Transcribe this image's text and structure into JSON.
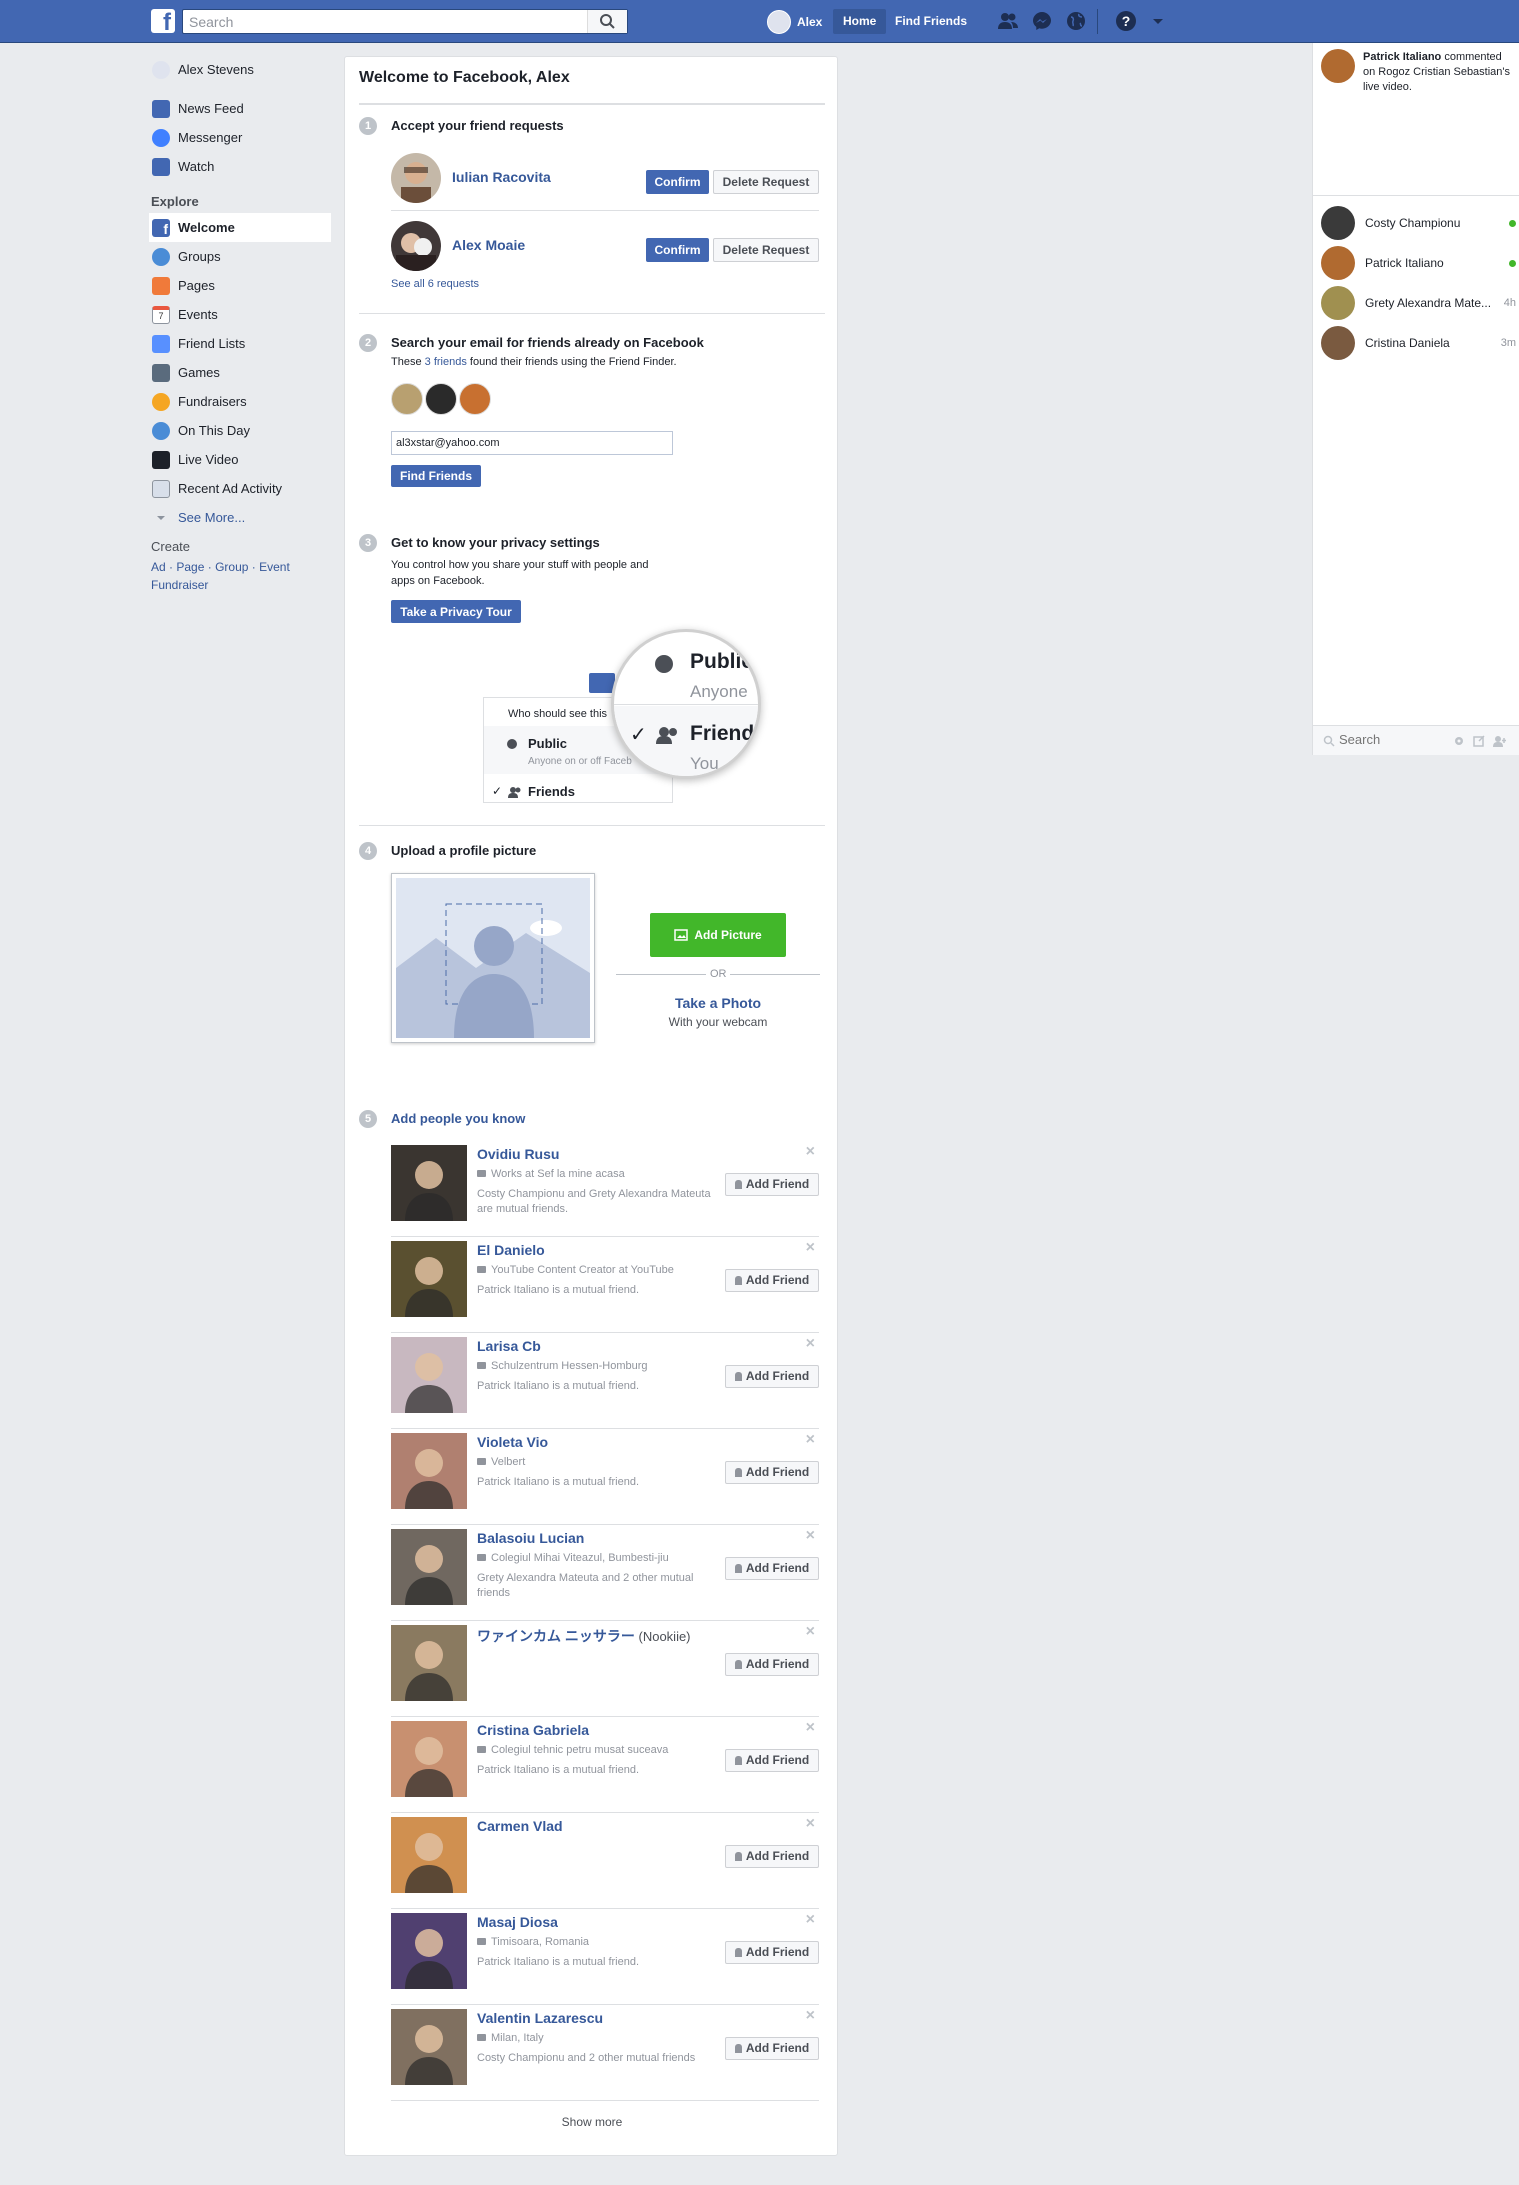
{
  "topbar": {
    "logo": "f",
    "search_placeholder": "Search",
    "user_name": "Alex",
    "home": "Home",
    "find_friends": "Find Friends",
    "brand_color": "#4267b2"
  },
  "left_nav": {
    "profile": "Alex Stevens",
    "items": [
      {
        "label": "News Feed",
        "icon": "news-feed-icon"
      },
      {
        "label": "Messenger",
        "icon": "messenger-icon"
      },
      {
        "label": "Watch",
        "icon": "watch-icon"
      }
    ],
    "explore_heading": "Explore",
    "explore": [
      {
        "label": "Welcome",
        "icon": "welcome-icon"
      },
      {
        "label": "Groups",
        "icon": "groups-icon"
      },
      {
        "label": "Pages",
        "icon": "pages-icon"
      },
      {
        "label": "Events",
        "icon": "events-icon"
      },
      {
        "label": "Friend Lists",
        "icon": "friend-lists-icon"
      },
      {
        "label": "Games",
        "icon": "games-icon"
      },
      {
        "label": "Fundraisers",
        "icon": "fundraisers-icon"
      },
      {
        "label": "On This Day",
        "icon": "on-this-day-icon"
      },
      {
        "label": "Live Video",
        "icon": "live-video-icon"
      },
      {
        "label": "Recent Ad Activity",
        "icon": "recent-ad-activity-icon"
      }
    ],
    "see_more": "See More...",
    "create_heading": "Create",
    "create_links": [
      "Ad",
      "Page",
      "Group",
      "Event"
    ],
    "create_fundraiser": "Fundraiser"
  },
  "main": {
    "title": "Welcome to Facebook, Alex",
    "step1": {
      "num": "1",
      "title": "Accept your friend requests",
      "requests": [
        {
          "name": "Iulian Racovita",
          "confirm": "Confirm",
          "delete": "Delete Request"
        },
        {
          "name": "Alex Moaie",
          "confirm": "Confirm",
          "delete": "Delete Request"
        }
      ],
      "see_all": "See all 6 requests"
    },
    "step2": {
      "num": "2",
      "title": "Search your email for friends already on Facebook",
      "desc_pre": "These ",
      "desc_link": "3 friends",
      "desc_post": " found their friends using the Friend Finder.",
      "email": "al3xstar@yahoo.com",
      "button": "Find Friends"
    },
    "step3": {
      "num": "3",
      "title": "Get to know your privacy settings",
      "desc": "You control how you share your stuff with people and apps on Facebook.",
      "button": "Take a Privacy Tour",
      "illus_who": "Who should see this",
      "illus_public": "Public",
      "illus_public_sub": "Anyone on or off Faceb",
      "illus_friends": "Friends",
      "zoom_public": "Public",
      "zoom_anyone": "Anyone",
      "zoom_friends": "Friend",
      "zoom_you": "You"
    },
    "step4": {
      "num": "4",
      "title": "Upload a profile picture",
      "add_picture": "Add Picture",
      "or": "OR",
      "take_photo": "Take a Photo",
      "webcam": "With your webcam"
    },
    "step5": {
      "num": "5",
      "title": "Add people you know",
      "add_label": "Add Friend",
      "people": [
        {
          "name": "Ovidiu Rusu",
          "sub": "Works at Sef la mine acasa",
          "mutual": "Costy Championu and Grety Alexandra Mateuta are mutual friends.",
          "photo": "#3a3530"
        },
        {
          "name": "El Danielo",
          "sub": "YouTube Content Creator at YouTube",
          "mutual": "Patrick Italiano is a mutual friend.",
          "photo": "#5a5030"
        },
        {
          "name": "Larisa Cb",
          "sub": "Schulzentrum Hessen-Homburg",
          "mutual": "Patrick Italiano is a mutual friend.",
          "photo": "#c8b8c0"
        },
        {
          "name": "Violeta Vio",
          "sub": "Velbert",
          "mutual": "Patrick Italiano is a mutual friend.",
          "photo": "#b08070"
        },
        {
          "name": "Balasoiu Lucian",
          "sub": "Colegiul Mihai Viteazul, Bumbesti-jiu",
          "mutual": "Grety Alexandra Mateuta and 2 other mutual friends",
          "photo": "#706860"
        },
        {
          "name": "ワァインカム ニッサラー",
          "name_extra": " (Nookiie)",
          "sub": "",
          "mutual": "",
          "photo": "#8a7a60"
        },
        {
          "name": "Cristina Gabriela",
          "sub": "Colegiul tehnic petru musat suceava",
          "mutual": "Patrick Italiano is a mutual friend.",
          "photo": "#c89070"
        },
        {
          "name": "Carmen Vlad",
          "sub": "",
          "mutual": "",
          "photo": "#d09050"
        },
        {
          "name": "Masaj Diosa",
          "sub": "Timisoara, Romania",
          "mutual": "Patrick Italiano is a mutual friend.",
          "photo": "#504070"
        },
        {
          "name": "Valentin Lazarescu",
          "sub": "Milan, Italy",
          "mutual": "Costy Championu and 2 other mutual friends",
          "photo": "#807060"
        }
      ],
      "show_more": "Show more"
    }
  },
  "right": {
    "ticker_name": "Patrick Italiano",
    "ticker_text": " commented on Rogoz Cristian Sebastian's live video.",
    "chats": [
      {
        "name": "Costy Championu",
        "status": "online",
        "time": ""
      },
      {
        "name": "Patrick Italiano",
        "status": "online",
        "time": ""
      },
      {
        "name": "Grety Alexandra Mate...",
        "status": "away",
        "time": "4h"
      },
      {
        "name": "Cristina Daniela",
        "status": "away",
        "time": "3m"
      }
    ],
    "search_placeholder": "Search"
  }
}
